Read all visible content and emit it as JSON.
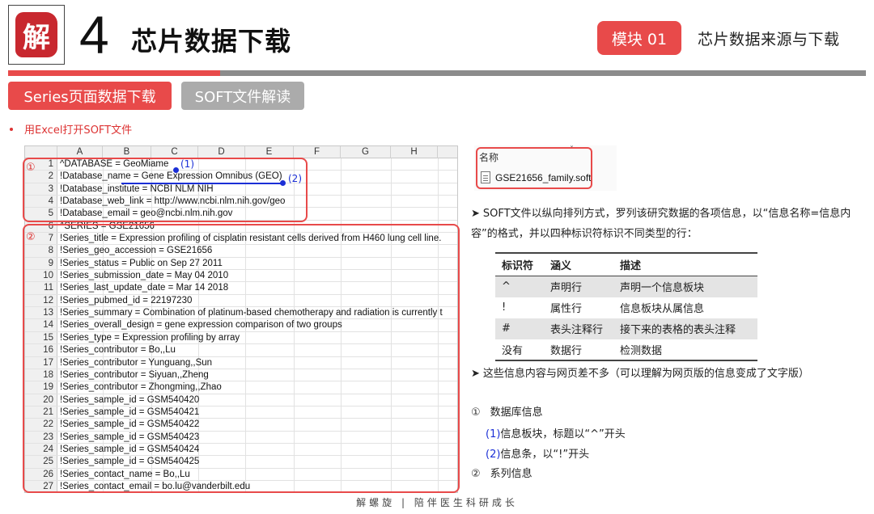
{
  "header": {
    "logo_char": "解",
    "chapter_number": "4",
    "chapter_title": "芯片数据下载",
    "module_badge": "模块 01",
    "module_title": "芯片数据来源与下载"
  },
  "tabs": [
    {
      "label": "Series页面数据下载",
      "active": true
    },
    {
      "label": "SOFT文件解读",
      "active": false
    }
  ],
  "bullet": "用Excel打开SOFT文件",
  "sheet": {
    "columns": [
      "A",
      "B",
      "C",
      "D",
      "E",
      "F",
      "G",
      "H"
    ],
    "rows": [
      {
        "num": "1",
        "text": "^DATABASE = GeoMiame"
      },
      {
        "num": "2",
        "text": "!Database_name = Gene Expression Omnibus (GEO)"
      },
      {
        "num": "3",
        "text": "!Database_institute = NCBI NLM NIH"
      },
      {
        "num": "4",
        "text": "!Database_web_link = http://www.ncbi.nlm.nih.gov/geo"
      },
      {
        "num": "5",
        "text": "!Database_email = geo@ncbi.nlm.nih.gov"
      },
      {
        "num": "6",
        "text": "^SERIES = GSE21656"
      },
      {
        "num": "7",
        "text": "!Series_title = Expression profiling of cisplatin resistant cells derived from H460 lung cell line."
      },
      {
        "num": "8",
        "text": "!Series_geo_accession = GSE21656"
      },
      {
        "num": "9",
        "text": "!Series_status = Public on Sep 27 2011"
      },
      {
        "num": "10",
        "text": "!Series_submission_date = May 04 2010"
      },
      {
        "num": "11",
        "text": "!Series_last_update_date = Mar 14 2018"
      },
      {
        "num": "12",
        "text": "!Series_pubmed_id = 22197230"
      },
      {
        "num": "13",
        "text": "!Series_summary = Combination of platinum-based chemotherapy and radiation is currently t"
      },
      {
        "num": "14",
        "text": "!Series_overall_design = gene expression comparison of two groups"
      },
      {
        "num": "15",
        "text": "!Series_type = Expression profiling by array"
      },
      {
        "num": "16",
        "text": "!Series_contributor = Bo,,Lu"
      },
      {
        "num": "17",
        "text": "!Series_contributor = Yunguang,,Sun"
      },
      {
        "num": "18",
        "text": "!Series_contributor = Siyuan,,Zheng"
      },
      {
        "num": "19",
        "text": "!Series_contributor = Zhongming,,Zhao"
      },
      {
        "num": "20",
        "text": "!Series_sample_id = GSM540420"
      },
      {
        "num": "21",
        "text": "!Series_sample_id = GSM540421"
      },
      {
        "num": "22",
        "text": "!Series_sample_id = GSM540422"
      },
      {
        "num": "23",
        "text": "!Series_sample_id = GSM540423"
      },
      {
        "num": "24",
        "text": "!Series_sample_id = GSM540424"
      },
      {
        "num": "25",
        "text": "!Series_sample_id = GSM540425"
      },
      {
        "num": "26",
        "text": "!Series_contact_name = Bo,,Lu"
      },
      {
        "num": "27",
        "text": "!Series_contact_email = bo.lu@vanderbilt.edu"
      }
    ],
    "marker_1": "①",
    "marker_2": "②",
    "ann_1": "(1)",
    "ann_2": "(2)"
  },
  "file": {
    "label": "名称",
    "name": "GSE21656_family.soft"
  },
  "description": {
    "para1": "SOFT文件以纵向排列方式，罗列该研究数据的各项信息，以“信息名称=信息内容”的格式，并以四种标识符标识不同类型的行：",
    "para2": "这些信息内容与网页差不多（可以理解为网页版的信息变成了文字版）"
  },
  "code_table": {
    "headers": [
      "标识符",
      "涵义",
      "描述"
    ],
    "rows": [
      [
        "^",
        "声明行",
        "声明一个信息板块"
      ],
      [
        "!",
        "属性行",
        "信息板块从属信息"
      ],
      [
        "#",
        "表头注释行",
        "接下来的表格的表头注释"
      ],
      [
        "没有",
        "数据行",
        "检测数据"
      ]
    ]
  },
  "legend": {
    "item1_num": "①",
    "item1": "数据库信息",
    "sub1_num": "(1)",
    "sub1": "信息板块，标题以“^”开头",
    "sub2_num": "(2)",
    "sub2": "信息条，以“!”开头",
    "item2_num": "②",
    "item2": "系列信息"
  },
  "footer": "解螺旋 | 陪伴医生科研成长",
  "colors": {
    "accent": "#e84a4a",
    "grey": "#ababab",
    "annotation_blue": "#1b2fd6"
  }
}
